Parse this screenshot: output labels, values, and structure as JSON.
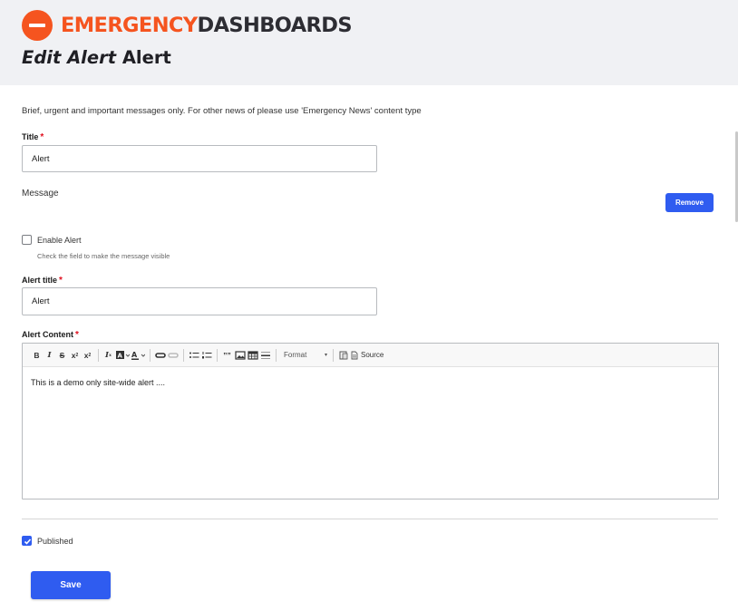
{
  "brand": {
    "logo_part1": "EMERGENCY",
    "logo_part2": "DASHBOARDS",
    "logo_icon": "minus-circle-icon",
    "accent_color": "#f5541f"
  },
  "page": {
    "title_prefix": "Edit",
    "title_type": "Alert",
    "title_node": "Alert",
    "description": "Brief, urgent and important messages only. For other news of please use 'Emergency News' content type"
  },
  "form": {
    "title_label": "Title",
    "title_value": "Alert",
    "message_section": "Message",
    "remove_label": "Remove",
    "enable_label": "Enable Alert",
    "enable_help": "Check the field to make the message visible",
    "enable_checked": false,
    "alert_title_label": "Alert title",
    "alert_title_value": "Alert",
    "alert_content_label": "Alert Content",
    "required_mark": "*",
    "published_label": "Published",
    "published_checked": true,
    "save_label": "Save"
  },
  "editor": {
    "format_label": "Format",
    "source_label": "Source",
    "body_text": "This is a demo only site-wide alert ....",
    "toolbar_icons": [
      "bold-icon",
      "italic-icon",
      "strikethrough-icon",
      "superscript-icon",
      "subscript-icon",
      "remove-format-icon",
      "background-color-icon",
      "text-color-icon",
      "link-icon",
      "unlink-icon",
      "bulleted-list-icon",
      "numbered-list-icon",
      "blockquote-icon",
      "image-icon",
      "table-icon",
      "horizontal-line-icon",
      "format-dropdown",
      "paste-icon",
      "source-icon"
    ]
  },
  "colors": {
    "primary_button": "#2f5cf0",
    "required": "#e0101f",
    "header_bg": "#f0f1f4"
  }
}
